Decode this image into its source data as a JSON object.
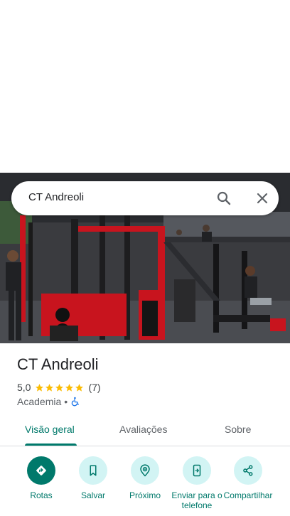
{
  "search": {
    "query": "CT Andreoli"
  },
  "place": {
    "name": "CT Andreoli",
    "rating": "5,0",
    "stars": 5,
    "review_count": "(7)",
    "category": "Academia",
    "category_separator": "•"
  },
  "tabs": [
    {
      "label": "Visão geral",
      "active": true
    },
    {
      "label": "Avaliações",
      "active": false
    },
    {
      "label": "Sobre",
      "active": false
    }
  ],
  "actions": [
    {
      "label": "Rotas",
      "icon": "directions-icon"
    },
    {
      "label": "Salvar",
      "icon": "bookmark-icon"
    },
    {
      "label": "Próximo",
      "icon": "nearby-icon"
    },
    {
      "label": "Enviar para o telefone",
      "icon": "send-to-phone-icon"
    },
    {
      "label": "Compartilhar",
      "icon": "share-icon"
    }
  ],
  "colors": {
    "accent": "#00796b",
    "action_bg": "#d2f4f4",
    "star": "#fbbc04",
    "gym_red": "#c8141e"
  }
}
